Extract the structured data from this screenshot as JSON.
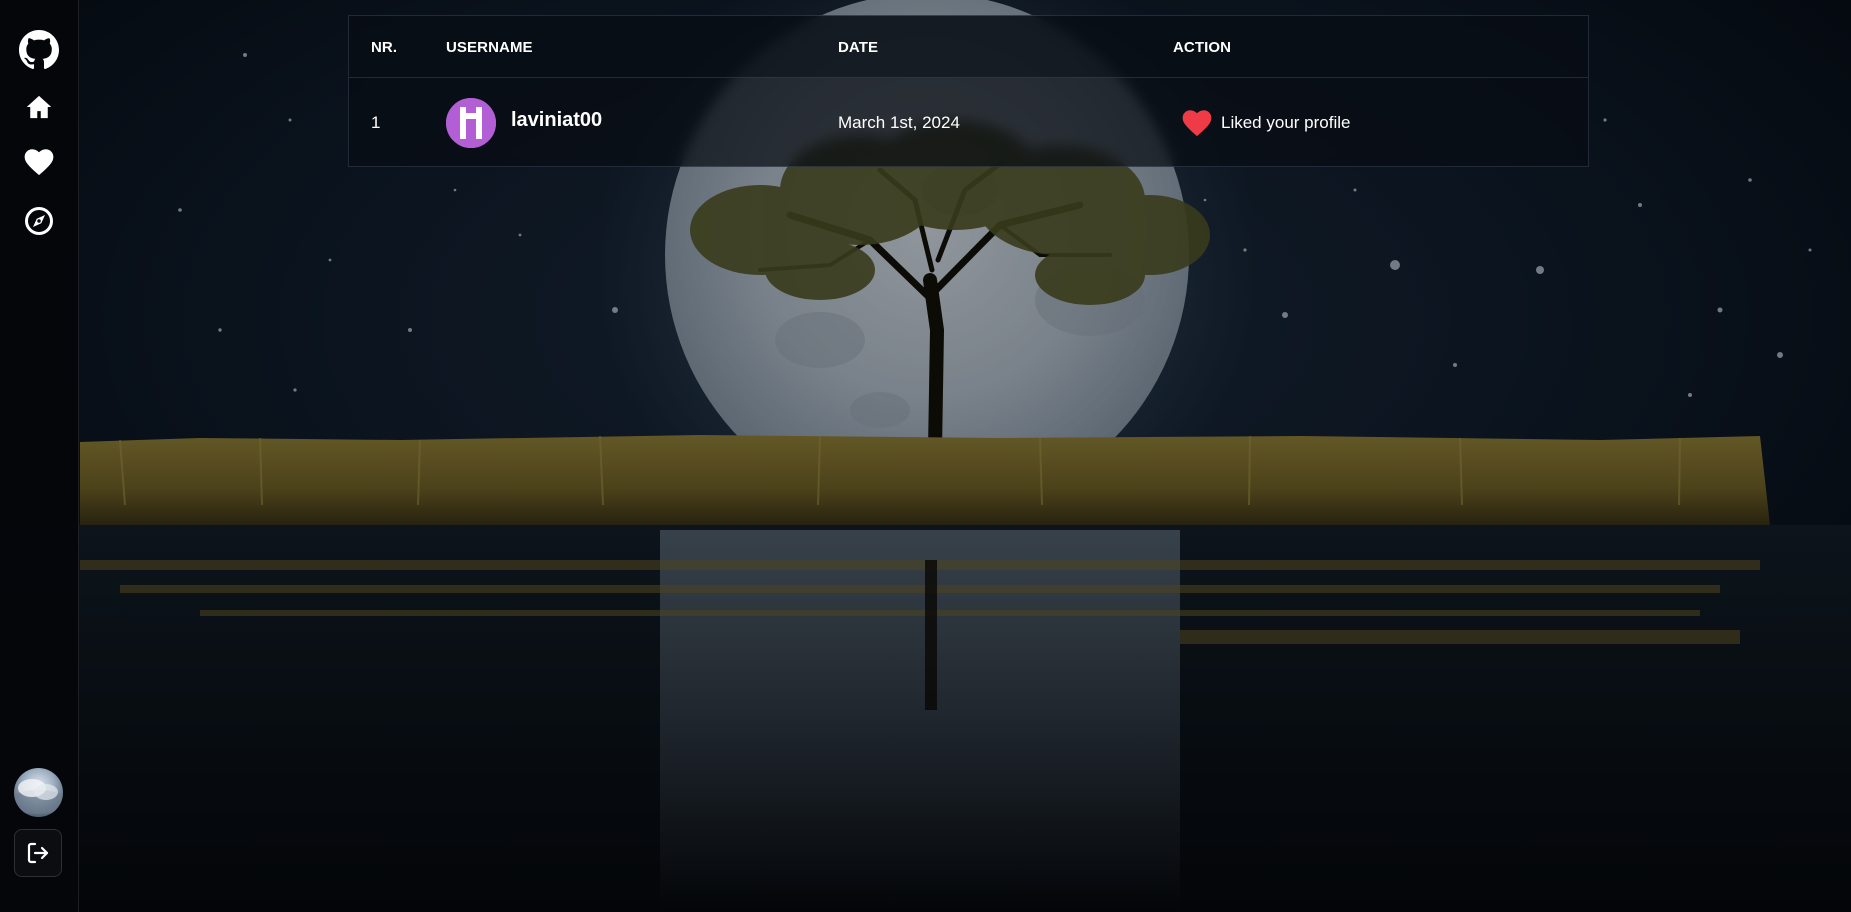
{
  "sidebar": {
    "items": [
      {
        "name": "github-logo",
        "icon": "github-icon"
      },
      {
        "name": "home",
        "icon": "home-icon"
      },
      {
        "name": "likes",
        "icon": "heart-icon"
      },
      {
        "name": "explore",
        "icon": "compass-icon"
      }
    ],
    "bottom": {
      "avatar_icon": "user-avatar",
      "logout_icon": "logout-icon"
    }
  },
  "table": {
    "headers": {
      "nr": "NR.",
      "username": "USERNAME",
      "date": "DATE",
      "action": "ACTION"
    },
    "rows": [
      {
        "nr": "1",
        "username": "laviniat00",
        "avatar_color": "#b25fd6",
        "date": "March 1st, 2024",
        "action_icon": "heart-icon",
        "action_icon_color": "#ef3b46",
        "action": "Liked your profile"
      }
    ]
  },
  "colors": {
    "sidebar_bg": "#05070c",
    "text": "#ffffff",
    "heart": "#ef3b46",
    "avatar_purple": "#b25fd6"
  }
}
